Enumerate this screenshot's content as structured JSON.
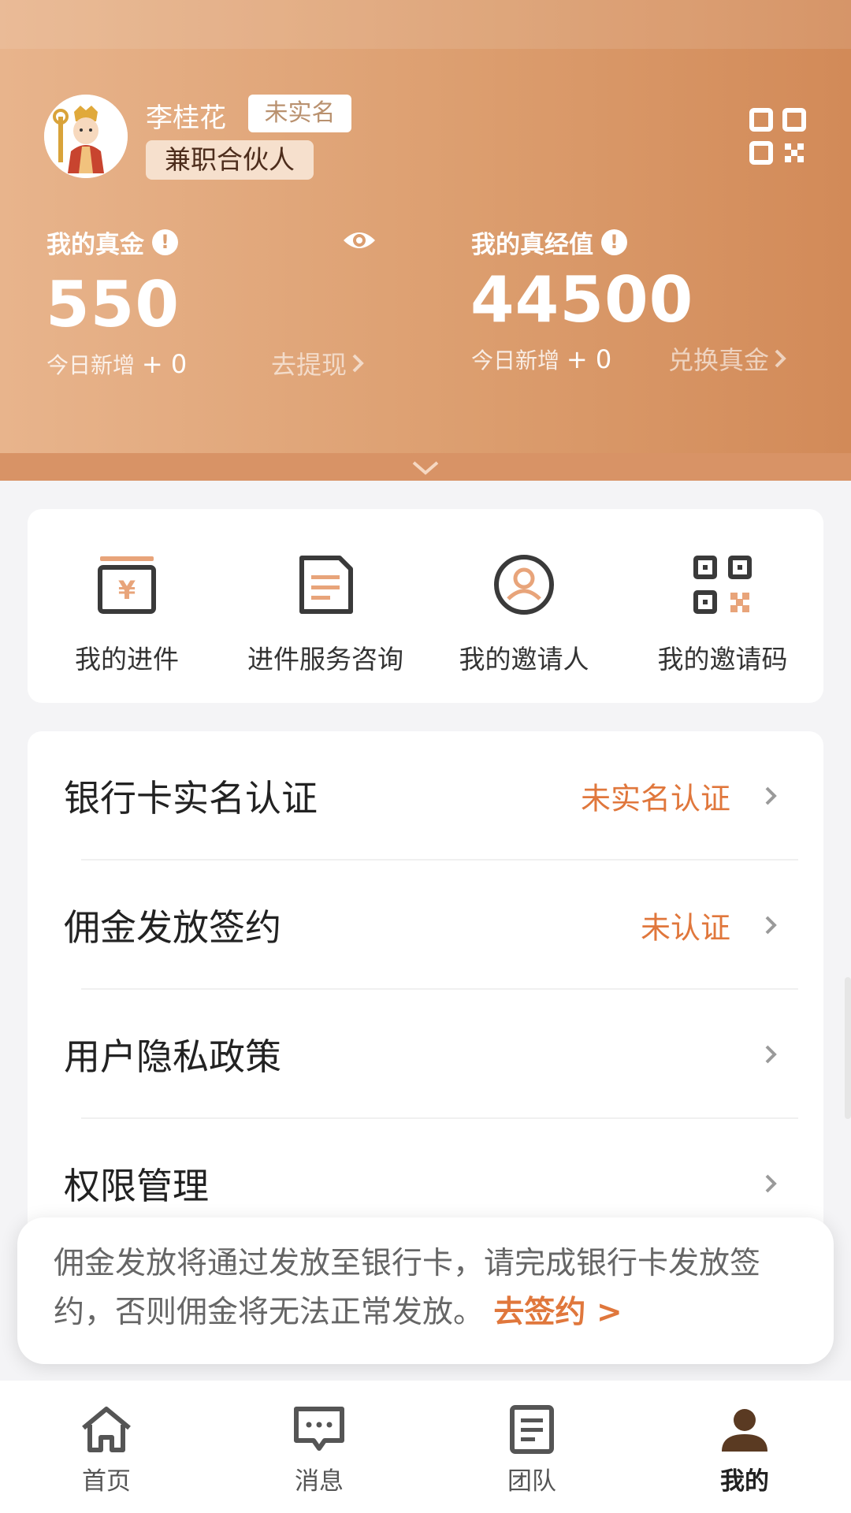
{
  "user": {
    "name": "李桂花",
    "realname_tag": "未实名",
    "role": "兼职合伙人"
  },
  "stats": {
    "gold": {
      "label": "我的真金",
      "value": "550",
      "today_label": "今日新增",
      "today_value": "+ 0",
      "action": "去提现"
    },
    "points": {
      "label": "我的真经值",
      "value": "44500",
      "today_label": "今日新增",
      "today_value": "+ 0",
      "action": "兑换真金"
    }
  },
  "quick_actions": [
    {
      "label": "我的进件",
      "icon": "money-card-icon"
    },
    {
      "label": "进件服务咨询",
      "icon": "document-icon"
    },
    {
      "label": "我的邀请人",
      "icon": "user-circle-icon"
    },
    {
      "label": "我的邀请码",
      "icon": "qrcode-icon"
    }
  ],
  "settings": [
    {
      "label": "银行卡实名认证",
      "status": "未实名认证"
    },
    {
      "label": "佣金发放签约",
      "status": "未认证"
    },
    {
      "label": "用户隐私政策",
      "status": ""
    },
    {
      "label": "权限管理",
      "status": ""
    }
  ],
  "notice": {
    "text": "佣金发放将通过发放至银行卡，请完成银行卡发放签约，否则佣金将无法正常发放。",
    "link": "去签约 >"
  },
  "tabs": [
    {
      "label": "首页",
      "icon": "home-icon"
    },
    {
      "label": "消息",
      "icon": "message-icon"
    },
    {
      "label": "团队",
      "icon": "team-icon"
    },
    {
      "label": "我的",
      "icon": "profile-icon"
    }
  ],
  "colors": {
    "brand": "#dc9e6f",
    "accent": "#e0773c",
    "icon_dark": "#3a3a3a",
    "icon_accent": "#e8a47a"
  }
}
